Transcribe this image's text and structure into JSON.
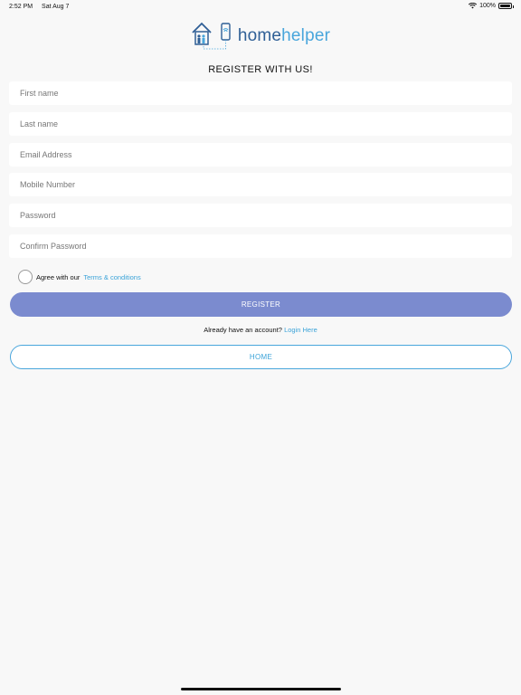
{
  "status_bar": {
    "time": "2:52 PM",
    "date": "Sat Aug 7",
    "battery": "100%",
    "battery_level": 1.0,
    "wifi_icon": "wifi-icon",
    "battery_icon": "battery-icon"
  },
  "logo": {
    "part1": "home",
    "part2": "helper",
    "icon": "house-phone-logo-icon"
  },
  "title": "REGISTER WITH US!",
  "form": {
    "first_name": {
      "placeholder": "First name",
      "value": ""
    },
    "last_name": {
      "placeholder": "Last name",
      "value": ""
    },
    "email": {
      "placeholder": "Email Address",
      "value": ""
    },
    "mobile": {
      "placeholder": "Mobile Number",
      "value": ""
    },
    "password": {
      "placeholder": "Password",
      "value": ""
    },
    "confirm_password": {
      "placeholder": "Confirm Password",
      "value": ""
    }
  },
  "agree": {
    "text": "Agree with our",
    "link": "Terms & conditions",
    "checked": false
  },
  "register_label": "REGISTER",
  "login": {
    "text": "Already have an account?",
    "link": "Login Here"
  },
  "home_label": "HOME",
  "colors": {
    "primary_button": "#7b8bcf",
    "accent": "#49a6dc",
    "brand_dark": "#2f5f96",
    "background": "#f8f8f8"
  }
}
